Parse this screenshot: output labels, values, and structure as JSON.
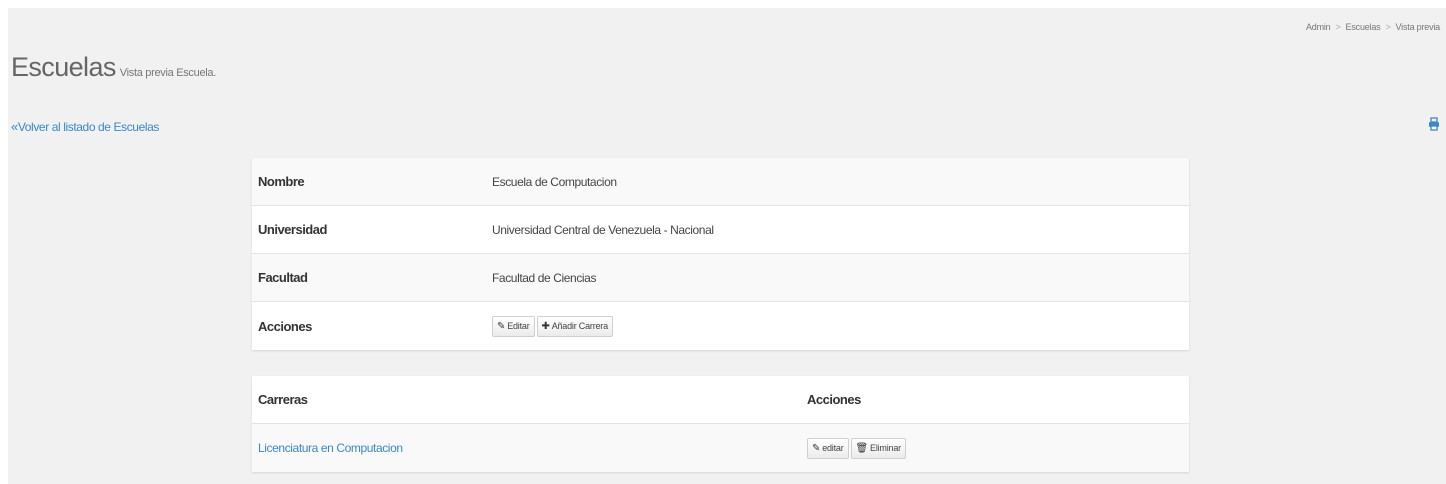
{
  "breadcrumb": [
    "Admin",
    "Escuelas",
    "Vista previa"
  ],
  "header": {
    "title": "Escuelas",
    "subtitle": "Vista previa Escuela."
  },
  "back_link": "Volver al listado de Escuelas",
  "print_icon": "print-icon",
  "details": {
    "rows": [
      {
        "label": "Nombre",
        "value": "Escuela de Computacion"
      },
      {
        "label": "Universidad",
        "value": "Universidad Central de Venezuela - Nacional"
      },
      {
        "label": "Facultad",
        "value": "Facultad de Ciencias"
      }
    ],
    "actions_label": "Acciones",
    "edit_button": "Editar",
    "add_career_button": "Añadir Carrera"
  },
  "careers": {
    "headers": [
      "Carreras",
      "Acciones"
    ],
    "items": [
      {
        "name": "Licenciatura en Computacion",
        "edit": "editar",
        "delete": "Eliminar"
      }
    ]
  },
  "colors": {
    "link": "#3a88c9",
    "page_bg": "#f1f1f1"
  }
}
